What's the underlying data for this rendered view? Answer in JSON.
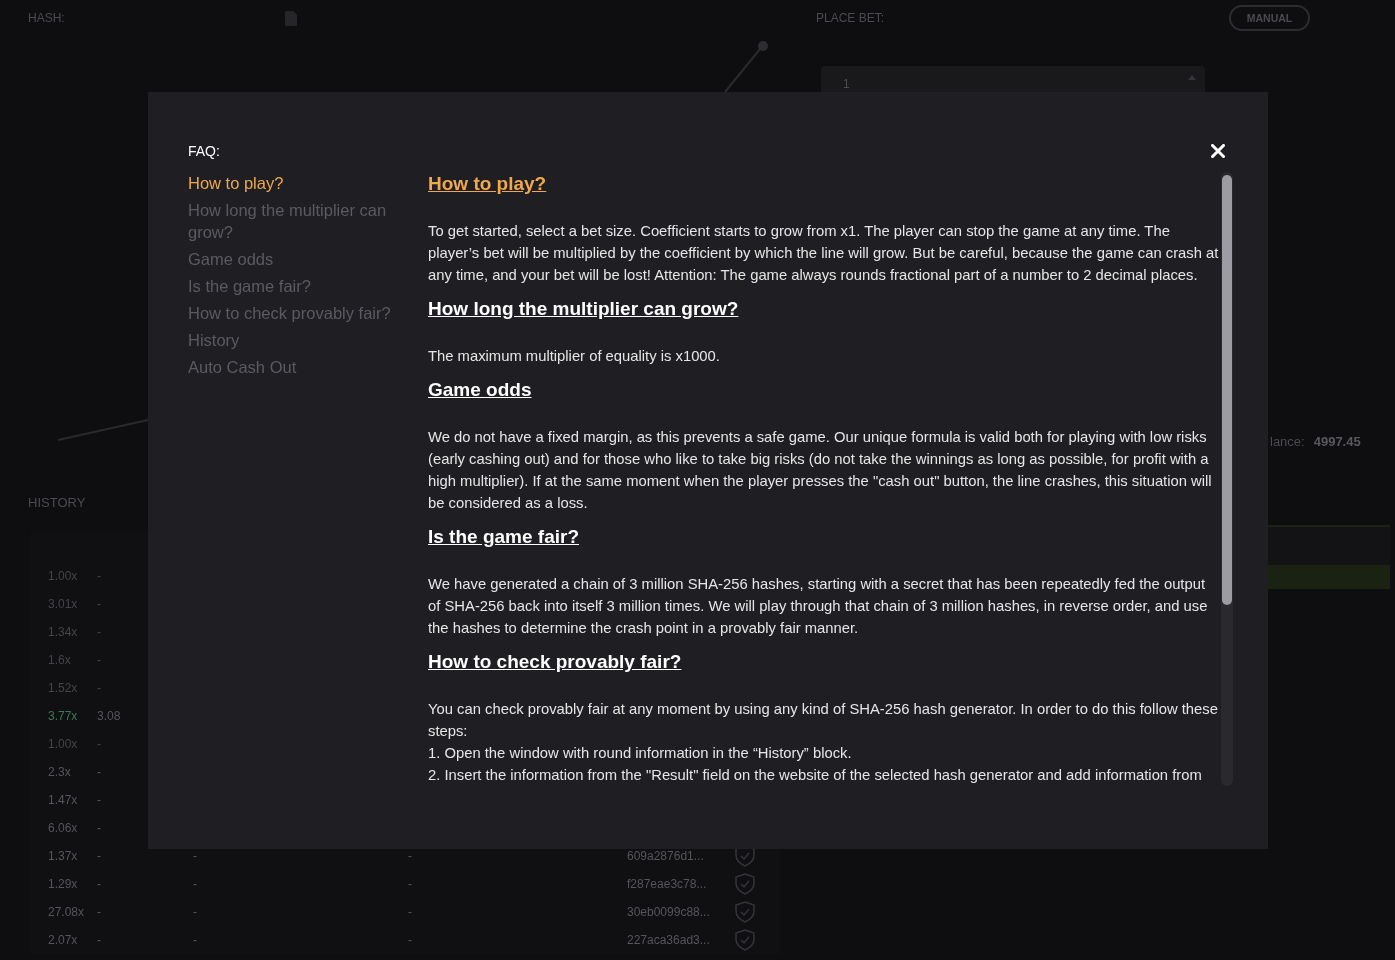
{
  "game": {
    "hash_label": "HASH:",
    "place_bet_label": "PLACE BET:",
    "mode_button": "MANUAL",
    "bet_input": {
      "value": "1"
    },
    "balance": {
      "label": "lance:",
      "value": "4997.45"
    },
    "history": {
      "title": "HISTORY",
      "rows": [
        {
          "multiplier": "1.00x",
          "cashout": "-",
          "highlighted": false,
          "dimmed": true
        },
        {
          "multiplier": "3.01x",
          "cashout": "-",
          "highlighted": false,
          "dimmed": true
        },
        {
          "multiplier": "1.34x",
          "cashout": "-",
          "highlighted": false,
          "dimmed": true
        },
        {
          "multiplier": "1.6x",
          "cashout": "-",
          "highlighted": false,
          "dimmed": true
        },
        {
          "multiplier": "1.52x",
          "cashout": "-",
          "highlighted": false,
          "dimmed": true
        },
        {
          "multiplier": "3.77x",
          "cashout": "3.08",
          "highlighted": true,
          "dimmed": false
        },
        {
          "multiplier": "1.00x",
          "cashout": "-",
          "highlighted": false,
          "dimmed": true
        },
        {
          "multiplier": "2.3x",
          "cashout": "-",
          "highlighted": false,
          "dimmed": false
        },
        {
          "multiplier": "1.47x",
          "cashout": "-",
          "highlighted": false,
          "dimmed": false
        },
        {
          "multiplier": "6.06x",
          "cashout": "-",
          "highlighted": false,
          "dimmed": false
        },
        {
          "multiplier": "1.37x",
          "cashout": "-",
          "column_3": "-",
          "column_4": "-",
          "hash": "609a2876d1...",
          "highlighted": false,
          "dimmed": false
        },
        {
          "multiplier": "1.29x",
          "cashout": "-",
          "column_3": "-",
          "column_4": "-",
          "hash": "f287eae3c78...",
          "highlighted": false,
          "dimmed": false
        },
        {
          "multiplier": "27.08x",
          "cashout": "-",
          "column_3": "-",
          "column_4": "-",
          "hash": "30eb0099c88...",
          "highlighted": false,
          "dimmed": false
        },
        {
          "multiplier": "2.07x",
          "cashout": "-",
          "column_3": "-",
          "column_4": "-",
          "hash": "227aca36ad3...",
          "highlighted": false,
          "dimmed": false
        }
      ]
    }
  },
  "faq": {
    "title": "FAQ:",
    "menu": [
      {
        "label": "How to play?",
        "selected": true
      },
      {
        "label": "How long the multiplier can grow?",
        "selected": false
      },
      {
        "label": "Game odds",
        "selected": false
      },
      {
        "label": "Is the game fair?",
        "selected": false
      },
      {
        "label": "How to check provably fair?",
        "selected": false
      },
      {
        "label": "History",
        "selected": false
      },
      {
        "label": "Auto Cash Out",
        "selected": false
      }
    ],
    "sections": [
      {
        "heading": "How to play?",
        "highlighted": true,
        "paragraphs": [
          "To get started, select a bet size. Coefficient starts to grow from x1. The player can stop the game at any time. The player’s bet will be multiplied by the coefficient by which the line will grow. But be careful, because the game can crash at any time, and your bet will be lost! Attention: The game always rounds fractional part of a number to 2 decimal places."
        ]
      },
      {
        "heading": "How long the multiplier can grow?",
        "highlighted": false,
        "paragraphs": [
          "The maximum multiplier of equality is x1000."
        ]
      },
      {
        "heading": "Game odds",
        "highlighted": false,
        "paragraphs": [
          "We do not have a fixed margin, as this prevents a safe game. Our unique formula is valid both for playing with low risks (early cashing out) and for those who like to take big risks (do not take the winnings as long as possible, for profit with a high multiplier). If at the same moment when the player presses the \"cash out\" button, the line crashes, this situation will be considered as a loss."
        ]
      },
      {
        "heading": "Is the game fair?",
        "highlighted": false,
        "paragraphs": [
          "We have generated a chain of 3 million SHA-256 hashes, starting with a secret that has been repeatedly fed the output of SHA-256 back into itself 3 million times. We will play through that chain of 3 million hashes, in reverse order, and use the hashes to determine the crash point in a provably fair manner."
        ]
      },
      {
        "heading": "How to check provably fair?",
        "highlighted": false,
        "paragraphs": [
          "You can check provably fair at any moment by using any kind of SHA-256 hash generator. In order to do this follow these steps:",
          "1. Open the window with round information in the “History” block.",
          "2. Insert the information from the \"Result\" field on the website of the selected hash generator and add information from"
        ]
      }
    ]
  }
}
